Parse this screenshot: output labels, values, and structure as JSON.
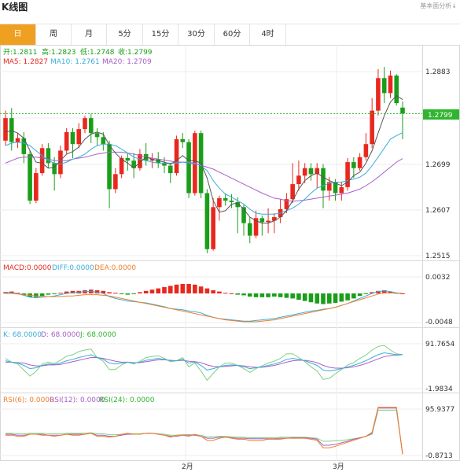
{
  "header": {
    "title": "K线图",
    "corner_text": "基本面分析↓"
  },
  "tabs": [
    {
      "label": "日",
      "active": true
    },
    {
      "label": "周",
      "active": false
    },
    {
      "label": "月",
      "active": false
    },
    {
      "label": "5分",
      "active": false
    },
    {
      "label": "15分",
      "active": false
    },
    {
      "label": "30分",
      "active": false
    },
    {
      "label": "60分",
      "active": false
    },
    {
      "label": "4时",
      "active": false
    }
  ],
  "colors": {
    "up": "#e8281e",
    "down": "#1a9e1a",
    "ma5": "#555555",
    "ma10": "#3aaed8",
    "ma20": "#a860c8",
    "price_line": "#2fb52f",
    "macd_diff": "#3aaed8",
    "macd_dea": "#f07f2a"
  },
  "info": {
    "open": "开:1.2811",
    "high": "高:1.2823",
    "low": "低:1.2748",
    "close": "收:1.2799",
    "ma5": "MA5: 1.2827",
    "ma10": "MA10: 1.2761",
    "ma20": "MA20: 1.2709"
  },
  "macd_info": {
    "macd": "MACD:0.0000",
    "diff": "DIFF:0.0000",
    "dea": "DEA:0.0000"
  },
  "kdj_info": {
    "k": "K: 68.0000",
    "d": "D: 68.0000",
    "j": "J: 68.0000"
  },
  "rsi_info": {
    "rsi6": "RSI(6): 0.0000",
    "rsi12": "RSI(12): 0.0000",
    "rsi24": "RSI(24): 0.0000"
  },
  "current_price": "1.2799",
  "chart_data": {
    "type": "candlestick",
    "price_axis": {
      "ticks": [
        "1.2883",
        "1.2791",
        "1.2699",
        "1.2607",
        "1.2515"
      ],
      "range": [
        1.2515,
        1.2883
      ]
    },
    "x_labels": [
      "2月",
      "3月"
    ],
    "candles": [
      [
        1.2745,
        1.279,
        1.2735,
        1.2805
      ],
      [
        1.279,
        1.2742,
        1.2725,
        1.281
      ],
      [
        1.2742,
        1.275,
        1.273,
        1.276
      ],
      [
        1.275,
        1.2718,
        1.27,
        1.2762
      ],
      [
        1.2718,
        1.2625,
        1.2618,
        1.2725
      ],
      [
        1.2625,
        1.268,
        1.262,
        1.269
      ],
      [
        1.268,
        1.273,
        1.2675,
        1.2738
      ],
      [
        1.273,
        1.27,
        1.269,
        1.274
      ],
      [
        1.27,
        1.2678,
        1.2645,
        1.2712
      ],
      [
        1.2678,
        1.2725,
        1.267,
        1.2735
      ],
      [
        1.2725,
        1.2762,
        1.2718,
        1.277
      ],
      [
        1.2762,
        1.2738,
        1.271,
        1.277
      ],
      [
        1.2738,
        1.2768,
        1.273,
        1.278
      ],
      [
        1.2768,
        1.279,
        1.276,
        1.2795
      ],
      [
        1.279,
        1.276,
        1.274,
        1.2798
      ],
      [
        1.276,
        1.2752,
        1.2735,
        1.277
      ],
      [
        1.2752,
        1.2738,
        1.2725,
        1.2762
      ],
      [
        1.2738,
        1.2648,
        1.261,
        1.2745
      ],
      [
        1.2648,
        1.2678,
        1.264,
        1.269
      ],
      [
        1.2678,
        1.271,
        1.267,
        1.2715
      ],
      [
        1.271,
        1.2705,
        1.2685,
        1.272
      ],
      [
        1.2705,
        1.269,
        1.267,
        1.272
      ],
      [
        1.269,
        1.2718,
        1.2685,
        1.2728
      ],
      [
        1.2718,
        1.2705,
        1.2695,
        1.274
      ],
      [
        1.2705,
        1.2708,
        1.269,
        1.272
      ],
      [
        1.2708,
        1.27,
        1.269,
        1.2722
      ],
      [
        1.27,
        1.2695,
        1.268,
        1.2712
      ],
      [
        1.2695,
        1.268,
        1.266,
        1.27
      ],
      [
        1.268,
        1.2748,
        1.2675,
        1.2755
      ],
      [
        1.2748,
        1.2742,
        1.273,
        1.276
      ],
      [
        1.2742,
        1.264,
        1.263,
        1.2748
      ],
      [
        1.264,
        1.276,
        1.2635,
        1.2765
      ],
      [
        1.276,
        1.264,
        1.263,
        1.2765
      ],
      [
        1.264,
        1.2528,
        1.252,
        1.2648
      ],
      [
        1.2528,
        1.2612,
        1.2525,
        1.263
      ],
      [
        1.2612,
        1.263,
        1.2585,
        1.2635
      ],
      [
        1.263,
        1.2625,
        1.2615,
        1.264
      ],
      [
        1.2625,
        1.2622,
        1.261,
        1.2638
      ],
      [
        1.2622,
        1.2612,
        1.256,
        1.2632
      ],
      [
        1.2612,
        1.258,
        1.2555,
        1.2618
      ],
      [
        1.258,
        1.2555,
        1.254,
        1.2592
      ],
      [
        1.2555,
        1.259,
        1.255,
        1.2605
      ],
      [
        1.259,
        1.2582,
        1.2555,
        1.2595
      ],
      [
        1.2582,
        1.2585,
        1.256,
        1.261
      ],
      [
        1.2585,
        1.2592,
        1.256,
        1.26
      ],
      [
        1.2592,
        1.2608,
        1.258,
        1.2628
      ],
      [
        1.2608,
        1.2628,
        1.26,
        1.264
      ],
      [
        1.2628,
        1.2658,
        1.262,
        1.27
      ],
      [
        1.2658,
        1.2675,
        1.2645,
        1.2705
      ],
      [
        1.2675,
        1.269,
        1.266,
        1.27
      ],
      [
        1.269,
        1.2678,
        1.2665,
        1.27
      ],
      [
        1.2678,
        1.269,
        1.265,
        1.27
      ],
      [
        1.269,
        1.2645,
        1.261,
        1.2698
      ],
      [
        1.2645,
        1.2662,
        1.2625,
        1.2672
      ],
      [
        1.2662,
        1.264,
        1.2625,
        1.2668
      ],
      [
        1.264,
        1.2652,
        1.2625,
        1.2662
      ],
      [
        1.2652,
        1.2702,
        1.2645,
        1.271
      ],
      [
        1.2702,
        1.269,
        1.267,
        1.2712
      ],
      [
        1.269,
        1.2712,
        1.2685,
        1.272
      ],
      [
        1.2712,
        1.2738,
        1.2705,
        1.276
      ],
      [
        1.2738,
        1.2805,
        1.273,
        1.283
      ],
      [
        1.2805,
        1.287,
        1.2795,
        1.2888
      ],
      [
        1.287,
        1.284,
        1.282,
        1.2892
      ],
      [
        1.284,
        1.2875,
        1.283,
        1.2885
      ],
      [
        1.2875,
        1.282,
        1.2815,
        1.2878
      ],
      [
        1.2811,
        1.2799,
        1.2748,
        1.2823
      ]
    ],
    "ma5": [
      1.2762,
      1.2765,
      1.276,
      1.275,
      1.2725,
      1.2702,
      1.27,
      1.269,
      1.2692,
      1.2705,
      1.2718,
      1.2723,
      1.2732,
      1.2748,
      1.2758,
      1.2762,
      1.2758,
      1.2736,
      1.272,
      1.2708,
      1.27,
      1.269,
      1.2702,
      1.2712,
      1.2708,
      1.2705,
      1.2702,
      1.2698,
      1.2705,
      1.2715,
      1.2705,
      1.2705,
      1.27,
      1.267,
      1.2625,
      1.2602,
      1.2605,
      1.2618,
      1.262,
      1.2608,
      1.2592,
      1.2585,
      1.258,
      1.258,
      1.2585,
      1.2592,
      1.2605,
      1.2625,
      1.2648,
      1.2665,
      1.2675,
      1.268,
      1.2672,
      1.2665,
      1.266,
      1.2655,
      1.2662,
      1.2675,
      1.2682,
      1.27,
      1.2725,
      1.276,
      1.2795,
      1.2822,
      1.2835,
      1.2827
    ],
    "ma10": [
      1.2735,
      1.274,
      1.2742,
      1.274,
      1.2735,
      1.2725,
      1.2715,
      1.2705,
      1.27,
      1.2698,
      1.2702,
      1.2708,
      1.2712,
      1.2718,
      1.2728,
      1.2735,
      1.2738,
      1.2738,
      1.2735,
      1.2728,
      1.272,
      1.2712,
      1.2708,
      1.2705,
      1.2702,
      1.27,
      1.27,
      1.27,
      1.27,
      1.2702,
      1.2702,
      1.27,
      1.2695,
      1.2685,
      1.2665,
      1.265,
      1.2638,
      1.2632,
      1.2625,
      1.2618,
      1.2608,
      1.26,
      1.2598,
      1.2598,
      1.2598,
      1.26,
      1.2605,
      1.261,
      1.2618,
      1.2628,
      1.264,
      1.265,
      1.2655,
      1.266,
      1.2662,
      1.2662,
      1.2665,
      1.2668,
      1.2672,
      1.268,
      1.2695,
      1.2712,
      1.273,
      1.2748,
      1.2755,
      1.2761
    ],
    "ma20": [
      1.27,
      1.2705,
      1.271,
      1.2712,
      1.2712,
      1.2712,
      1.271,
      1.2708,
      1.2705,
      1.2705,
      1.2705,
      1.2708,
      1.271,
      1.2712,
      1.2715,
      1.2718,
      1.272,
      1.2722,
      1.2722,
      1.2722,
      1.272,
      1.2718,
      1.2715,
      1.2712,
      1.271,
      1.2708,
      1.2706,
      1.2704,
      1.2702,
      1.2702,
      1.27,
      1.2698,
      1.2696,
      1.2692,
      1.2688,
      1.2682,
      1.2676,
      1.267,
      1.2664,
      1.2658,
      1.2652,
      1.2646,
      1.264,
      1.2635,
      1.263,
      1.2628,
      1.2625,
      1.2624,
      1.2625,
      1.2626,
      1.2628,
      1.263,
      1.2632,
      1.2634,
      1.2636,
      1.2638,
      1.264,
      1.2644,
      1.2648,
      1.2655,
      1.2663,
      1.2672,
      1.2682,
      1.2692,
      1.2702,
      1.2709
    ],
    "macd_axis": {
      "ticks": [
        "0.0032",
        "-0.0048"
      ],
      "range": [
        -0.005,
        0.0035
      ]
    },
    "macd_hist": [
      0.0002,
      0.0003,
      0.0001,
      -0.0003,
      -0.0006,
      -0.0006,
      -0.0004,
      -0.0002,
      -0.0001,
      0.0001,
      0.0003,
      0.0004,
      0.0004,
      0.0005,
      0.0006,
      0.0005,
      0.0004,
      0.0002,
      0.0001,
      -0.0001,
      -0.0002,
      -0.0001,
      0.0002,
      0.0004,
      0.0006,
      0.0008,
      0.001,
      0.0012,
      0.0014,
      0.0015,
      0.0015,
      0.0014,
      0.0011,
      0.0008,
      0.0005,
      0.0003,
      0.0001,
      0.0,
      -0.0002,
      -0.0003,
      -0.0005,
      -0.0006,
      -0.0006,
      -0.0006,
      -0.0005,
      -0.0006,
      -0.0007,
      -0.0008,
      -0.001,
      -0.0012,
      -0.0014,
      -0.0016,
      -0.0017,
      -0.0016,
      -0.0015,
      -0.0013,
      -0.0011,
      -0.0008,
      -0.0004,
      -0.0001,
      0.0002,
      0.0004,
      0.0005,
      0.0003,
      0.0001,
      0.0
    ],
    "macd_diff": [
      0.0002,
      0.0001,
      0.0,
      -0.0003,
      -0.0006,
      -0.0007,
      -0.0006,
      -0.0005,
      -0.0004,
      -0.0002,
      0.0,
      0.0001,
      0.0002,
      0.0003,
      0.0003,
      0.0002,
      0.0,
      -0.0005,
      -0.0008,
      -0.001,
      -0.0012,
      -0.0013,
      -0.0014,
      -0.0015,
      -0.0017,
      -0.0019,
      -0.0021,
      -0.0024,
      -0.0025,
      -0.0026,
      -0.0028,
      -0.0029,
      -0.0031,
      -0.0035,
      -0.0038,
      -0.004,
      -0.0041,
      -0.0042,
      -0.0043,
      -0.0044,
      -0.0044,
      -0.0043,
      -0.0042,
      -0.0041,
      -0.004,
      -0.0038,
      -0.0036,
      -0.0034,
      -0.0032,
      -0.003,
      -0.0028,
      -0.0027,
      -0.0025,
      -0.0024,
      -0.0022,
      -0.0019,
      -0.0016,
      -0.0012,
      -0.0008,
      -0.0004,
      0.0,
      0.0003,
      0.0004,
      0.0003,
      0.0001,
      0.0
    ],
    "macd_dea": [
      0.0,
      0.0,
      -0.0001,
      -0.0002,
      -0.0003,
      -0.0004,
      -0.0005,
      -0.0005,
      -0.0005,
      -0.0005,
      -0.0004,
      -0.0004,
      -0.0003,
      -0.0002,
      -0.0002,
      -0.0002,
      -0.0003,
      -0.0004,
      -0.0006,
      -0.0008,
      -0.001,
      -0.0012,
      -0.0014,
      -0.0016,
      -0.0018,
      -0.002,
      -0.0022,
      -0.0024,
      -0.0026,
      -0.0028,
      -0.003,
      -0.0032,
      -0.0034,
      -0.0036,
      -0.0038,
      -0.004,
      -0.0042,
      -0.0043,
      -0.0044,
      -0.0045,
      -0.0045,
      -0.0045,
      -0.0044,
      -0.0043,
      -0.0042,
      -0.004,
      -0.0038,
      -0.0036,
      -0.0034,
      -0.0032,
      -0.003,
      -0.0028,
      -0.0026,
      -0.0024,
      -0.0022,
      -0.0019,
      -0.0016,
      -0.0013,
      -0.001,
      -0.0007,
      -0.0004,
      -0.0001,
      0.0001,
      0.0001,
      0.0,
      0.0
    ],
    "kdj_axis": {
      "ticks": [
        "91.7654",
        "-1.9834"
      ],
      "range": [
        -10,
        100
      ]
    },
    "kdj_k": [
      55,
      52,
      50,
      45,
      38,
      40,
      45,
      48,
      47,
      50,
      55,
      58,
      62,
      65,
      68,
      62,
      58,
      50,
      48,
      50,
      52,
      50,
      52,
      56,
      58,
      60,
      58,
      55,
      55,
      58,
      50,
      52,
      45,
      35,
      38,
      42,
      45,
      46,
      45,
      42,
      38,
      40,
      42,
      45,
      48,
      52,
      58,
      60,
      58,
      55,
      50,
      45,
      35,
      33,
      35,
      38,
      42,
      45,
      50,
      55,
      62,
      68,
      72,
      70,
      68,
      68
    ],
    "kdj_d": [
      52,
      52,
      51,
      50,
      46,
      44,
      44,
      46,
      46,
      47,
      50,
      53,
      56,
      59,
      62,
      62,
      60,
      57,
      54,
      52,
      52,
      51,
      51,
      53,
      55,
      57,
      57,
      56,
      55,
      56,
      54,
      53,
      51,
      46,
      43,
      42,
      43,
      44,
      45,
      44,
      42,
      41,
      41,
      43,
      45,
      48,
      52,
      55,
      56,
      56,
      54,
      51,
      45,
      41,
      39,
      39,
      40,
      42,
      45,
      49,
      54,
      59,
      64,
      66,
      67,
      68
    ],
    "kdj_j": [
      60,
      52,
      48,
      35,
      22,
      32,
      48,
      52,
      49,
      56,
      65,
      68,
      75,
      78,
      80,
      62,
      54,
      36,
      36,
      46,
      52,
      48,
      54,
      62,
      64,
      66,
      60,
      53,
      55,
      62,
      42,
      50,
      33,
      13,
      28,
      42,
      50,
      50,
      45,
      38,
      30,
      38,
      44,
      50,
      54,
      60,
      70,
      70,
      62,
      53,
      42,
      33,
      15,
      17,
      27,
      36,
      46,
      51,
      60,
      67,
      78,
      86,
      88,
      78,
      70,
      68
    ],
    "rsi_axis": {
      "ticks": [
        "95.9377",
        "-0.8713"
      ],
      "range": [
        -5,
        100
      ]
    },
    "rsi6": [
      40,
      40,
      38,
      38,
      42,
      42,
      40,
      40,
      38,
      40,
      42,
      40,
      40,
      42,
      44,
      38,
      38,
      36,
      38,
      42,
      44,
      42,
      42,
      44,
      44,
      42,
      40,
      36,
      40,
      40,
      38,
      42,
      38,
      30,
      30,
      34,
      36,
      34,
      32,
      32,
      30,
      30,
      30,
      32,
      32,
      32,
      34,
      34,
      34,
      34,
      32,
      30,
      15,
      15,
      18,
      22,
      26,
      30,
      34,
      38,
      46,
      96,
      96,
      96,
      96,
      2
    ],
    "rsi12": [
      42,
      42,
      40,
      40,
      42,
      42,
      42,
      40,
      40,
      40,
      42,
      42,
      42,
      42,
      44,
      40,
      40,
      38,
      38,
      40,
      42,
      42,
      42,
      44,
      44,
      42,
      40,
      38,
      38,
      40,
      40,
      40,
      38,
      34,
      34,
      36,
      36,
      35,
      34,
      34,
      33,
      33,
      33,
      33,
      33,
      34,
      34,
      35,
      35,
      35,
      34,
      32,
      20,
      20,
      22,
      25,
      28,
      32,
      35,
      38,
      44,
      94,
      94,
      94,
      94,
      2
    ],
    "rsi24": [
      44,
      44,
      43,
      43,
      44,
      44,
      44,
      43,
      43,
      43,
      44,
      44,
      44,
      44,
      45,
      43,
      43,
      41,
      41,
      42,
      43,
      43,
      43,
      44,
      44,
      43,
      42,
      40,
      40,
      41,
      41,
      41,
      40,
      37,
      37,
      38,
      38,
      37,
      36,
      36,
      35,
      35,
      35,
      35,
      35,
      36,
      36,
      36,
      36,
      36,
      35,
      34,
      28,
      28,
      29,
      30,
      31,
      33,
      35,
      38,
      42,
      90,
      90,
      90,
      90,
      3
    ]
  }
}
